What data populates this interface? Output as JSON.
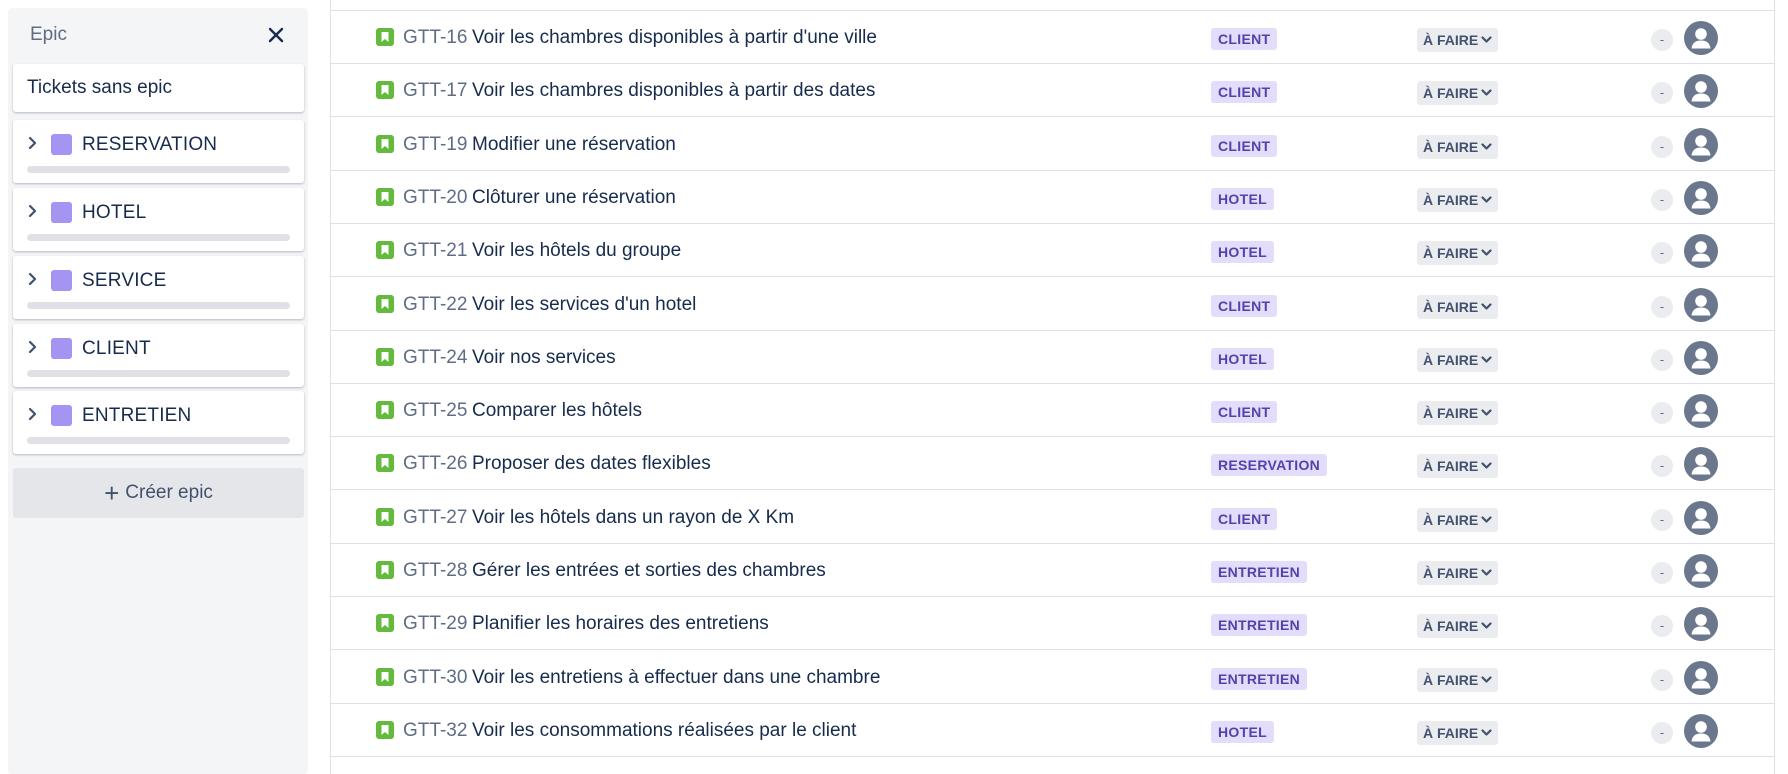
{
  "epic_panel": {
    "title": "Epic",
    "no_epic_label": "Tickets sans epic",
    "create_label": "Créer epic",
    "epics": [
      {
        "name": "RESERVATION",
        "color": "#a594f2"
      },
      {
        "name": "HOTEL",
        "color": "#a594f2"
      },
      {
        "name": "SERVICE",
        "color": "#a594f2"
      },
      {
        "name": "CLIENT",
        "color": "#a594f2"
      },
      {
        "name": "ENTRETIEN",
        "color": "#a594f2"
      }
    ]
  },
  "issues": [
    {
      "key": "GTT-16",
      "summary": "Voir les chambres disponibles à partir d'une ville",
      "epic": "CLIENT",
      "status": "À FAIRE",
      "estimate": "-"
    },
    {
      "key": "GTT-17",
      "summary": "Voir les chambres disponibles à partir des dates",
      "epic": "CLIENT",
      "status": "À FAIRE",
      "estimate": "-"
    },
    {
      "key": "GTT-19",
      "summary": "Modifier une réservation",
      "epic": "CLIENT",
      "status": "À FAIRE",
      "estimate": "-"
    },
    {
      "key": "GTT-20",
      "summary": "Clôturer une réservation",
      "epic": "HOTEL",
      "status": "À FAIRE",
      "estimate": "-"
    },
    {
      "key": "GTT-21",
      "summary": "Voir les hôtels du groupe",
      "epic": "HOTEL",
      "status": "À FAIRE",
      "estimate": "-"
    },
    {
      "key": "GTT-22",
      "summary": "Voir les services d'un hotel",
      "epic": "CLIENT",
      "status": "À FAIRE",
      "estimate": "-"
    },
    {
      "key": "GTT-24",
      "summary": "Voir nos services",
      "epic": "HOTEL",
      "status": "À FAIRE",
      "estimate": "-"
    },
    {
      "key": "GTT-25",
      "summary": "Comparer les hôtels",
      "epic": "CLIENT",
      "status": "À FAIRE",
      "estimate": "-"
    },
    {
      "key": "GTT-26",
      "summary": "Proposer des dates flexibles",
      "epic": "RESERVATION",
      "status": "À FAIRE",
      "estimate": "-"
    },
    {
      "key": "GTT-27",
      "summary": "Voir les hôtels dans un rayon de X Km",
      "epic": "CLIENT",
      "status": "À FAIRE",
      "estimate": "-"
    },
    {
      "key": "GTT-28",
      "summary": "Gérer les entrées et sorties des chambres",
      "epic": "ENTRETIEN",
      "status": "À FAIRE",
      "estimate": "-"
    },
    {
      "key": "GTT-29",
      "summary": "Planifier les horaires des entretiens",
      "epic": "ENTRETIEN",
      "status": "À FAIRE",
      "estimate": "-"
    },
    {
      "key": "GTT-30",
      "summary": "Voir les entretiens à effectuer dans une chambre",
      "epic": "ENTRETIEN",
      "status": "À FAIRE",
      "estimate": "-"
    },
    {
      "key": "GTT-32",
      "summary": "Voir les consommations réalisées par le client",
      "epic": "HOTEL",
      "status": "À FAIRE",
      "estimate": "-"
    }
  ]
}
